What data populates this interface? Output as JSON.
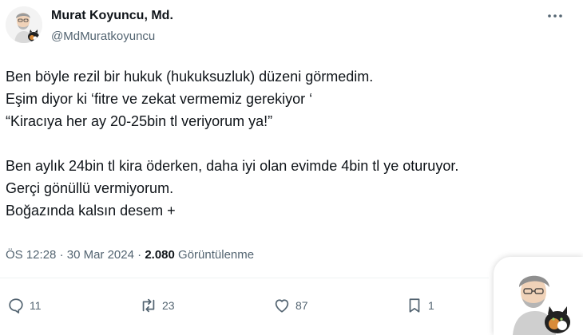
{
  "author": {
    "name": "Murat Koyuncu, Md.",
    "handle": "@MdMuratkoyuncu"
  },
  "tweet": {
    "lines": [
      "Ben böyle rezil bir hukuk (hukuksuzluk) düzeni görmedim.",
      "Eşim diyor ki ‘fitre ve zekat vermemiz gerekiyor ‘",
      "“Kiracıya her ay 20-25bin tl veriyorum ya!”",
      "",
      "Ben aylık 24bin tl kira öderken, daha iyi olan evimde 4bin tl ye oturuyor.",
      "Gerçi gönüllü vermiyorum.",
      "Boğazında kalsın desem +"
    ]
  },
  "meta": {
    "time": "ÖS 12:28",
    "separator": "·",
    "date": "30 Mar 2024",
    "views_count": "2.080",
    "views_label": "Görüntülenme"
  },
  "actions": {
    "replies": "11",
    "retweets": "23",
    "likes": "87",
    "bookmarks": "1"
  },
  "colors": {
    "text": "#0f1419",
    "secondary": "#536471",
    "divider": "#eff3f4"
  },
  "icons": [
    "more-icon",
    "reply-icon",
    "retweet-icon",
    "like-icon",
    "bookmark-icon"
  ]
}
